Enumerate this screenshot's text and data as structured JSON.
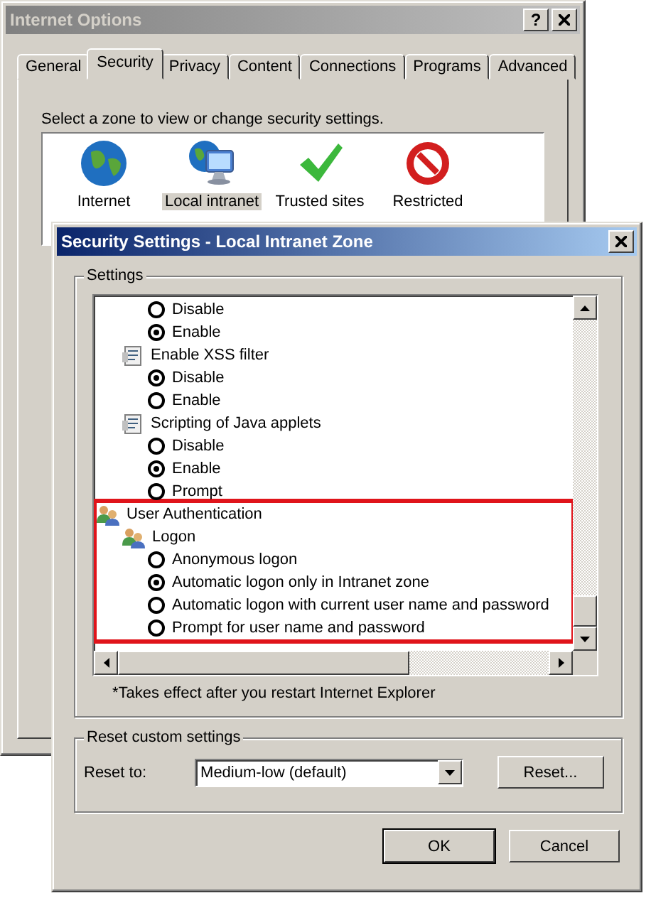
{
  "back_window": {
    "title": "Internet Options",
    "help_button": "?",
    "tabs": [
      {
        "label": "General",
        "selected": false
      },
      {
        "label": "Security",
        "selected": true
      },
      {
        "label": "Privacy",
        "selected": false
      },
      {
        "label": "Content",
        "selected": false
      },
      {
        "label": "Connections",
        "selected": false
      },
      {
        "label": "Programs",
        "selected": false
      },
      {
        "label": "Advanced",
        "selected": false
      }
    ],
    "zone_prompt": "Select a zone to view or change security settings.",
    "zones": [
      {
        "kind": "globe",
        "label": "Internet",
        "selected": false
      },
      {
        "kind": "intranet",
        "label": "Local intranet",
        "selected": true
      },
      {
        "kind": "trusted",
        "label": "Trusted sites",
        "selected": false
      },
      {
        "kind": "restricted",
        "label": "Restricted",
        "selected": false
      }
    ]
  },
  "dialog": {
    "title": "Security Settings - Local Intranet Zone",
    "settings_group": "Settings",
    "tree": [
      {
        "kind": "setting",
        "children": [
          {
            "kind": "radio",
            "label": "Disable",
            "selected": false
          },
          {
            "kind": "radio",
            "label": "Enable",
            "selected": true
          }
        ]
      },
      {
        "kind": "setting",
        "label": "Enable XSS filter",
        "children": [
          {
            "kind": "radio",
            "label": "Disable",
            "selected": true
          },
          {
            "kind": "radio",
            "label": "Enable",
            "selected": false
          }
        ]
      },
      {
        "kind": "setting",
        "label": "Scripting of Java applets",
        "children": [
          {
            "kind": "radio",
            "label": "Disable",
            "selected": false
          },
          {
            "kind": "radio",
            "label": "Enable",
            "selected": true
          },
          {
            "kind": "radio",
            "label": "Prompt",
            "selected": false
          }
        ]
      },
      {
        "kind": "category",
        "label": "User Authentication",
        "highlighted": true,
        "children": [
          {
            "kind": "category",
            "label": "Logon",
            "children": [
              {
                "kind": "radio",
                "label": "Anonymous logon",
                "selected": false
              },
              {
                "kind": "radio",
                "label": "Automatic logon only in Intranet zone",
                "selected": true
              },
              {
                "kind": "radio",
                "label": "Automatic logon with current user name and password",
                "selected": false
              },
              {
                "kind": "radio",
                "label": "Prompt for user name and password",
                "selected": false
              }
            ]
          }
        ]
      }
    ],
    "note": "*Takes effect after you restart Internet Explorer",
    "reset_group": {
      "title": "Reset custom settings",
      "label": "Reset to:",
      "value": "Medium-low (default)",
      "button": "Reset..."
    },
    "buttons": [
      "OK",
      "Cancel"
    ]
  }
}
